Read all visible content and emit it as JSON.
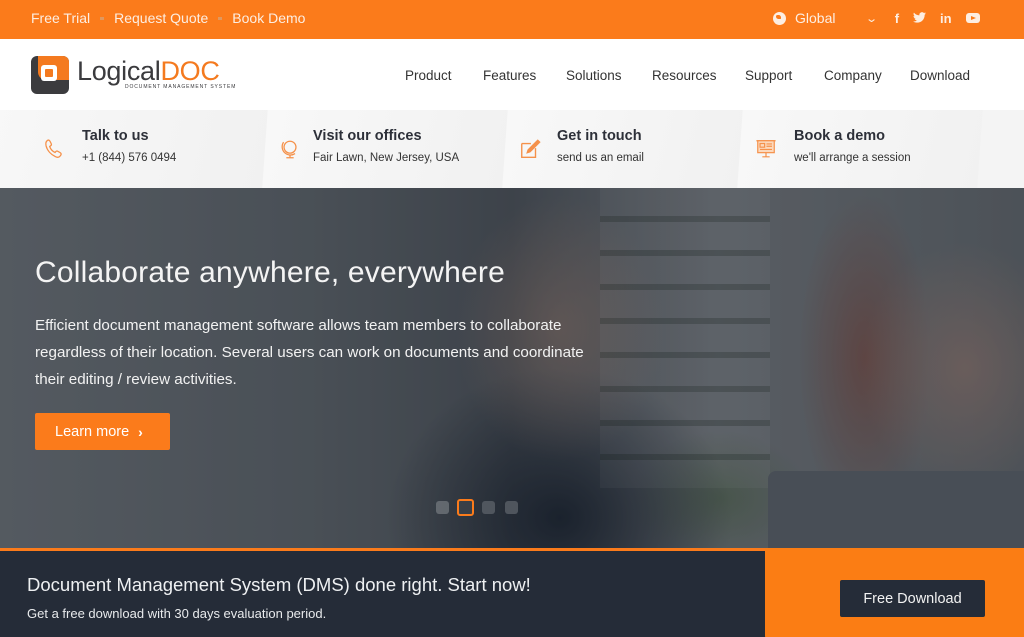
{
  "topbar": {
    "links": [
      "Free Trial",
      "Request Quote",
      "Book Demo"
    ],
    "region_label": "Global",
    "region_icon": "globe-icon",
    "social_icons": [
      "facebook-icon",
      "twitter-icon",
      "linkedin-icon",
      "youtube-icon"
    ],
    "social_glyphs": [
      "f",
      "🐦",
      "in",
      ""
    ]
  },
  "header": {
    "logo": {
      "word": "Logical",
      "accent": "DOC",
      "tagline": "DOCUMENT MANAGEMENT SYSTEM"
    },
    "nav": [
      "Product",
      "Features",
      "Solutions",
      "Resources",
      "Support",
      "Company",
      "Download"
    ]
  },
  "contacts": [
    {
      "icon": "phone-icon",
      "title": "Talk to us",
      "detail": "+1 (844) 576 0494"
    },
    {
      "icon": "globe-stand-icon",
      "title": "Visit our offices",
      "detail": "Fair Lawn, New Jersey, USA"
    },
    {
      "icon": "edit-note-icon",
      "title": "Get in touch",
      "detail": "send us an email"
    },
    {
      "icon": "presentation-board-icon",
      "title": "Book a demo",
      "detail": "we'll arrange a session"
    }
  ],
  "hero": {
    "title": "Collaborate anywhere, everywhere",
    "text": "Efficient document management software allows team members to collaborate regardless of their location. Several users can work on documents and coordinate their editing / review activities.",
    "button_label": "Learn more",
    "button_icon": "chevron-right-icon",
    "slides_total": 4,
    "active_slide": 2
  },
  "cta": {
    "title": "Document Management System (DMS) done right. Start now!",
    "subtitle": "Get a free download with 30 days evaluation period.",
    "button_label": "Free Download"
  },
  "colors": {
    "brand_orange": "#fb7b1b",
    "dark_navy": "#252c38",
    "logo_gray": "#3b3b3e"
  }
}
